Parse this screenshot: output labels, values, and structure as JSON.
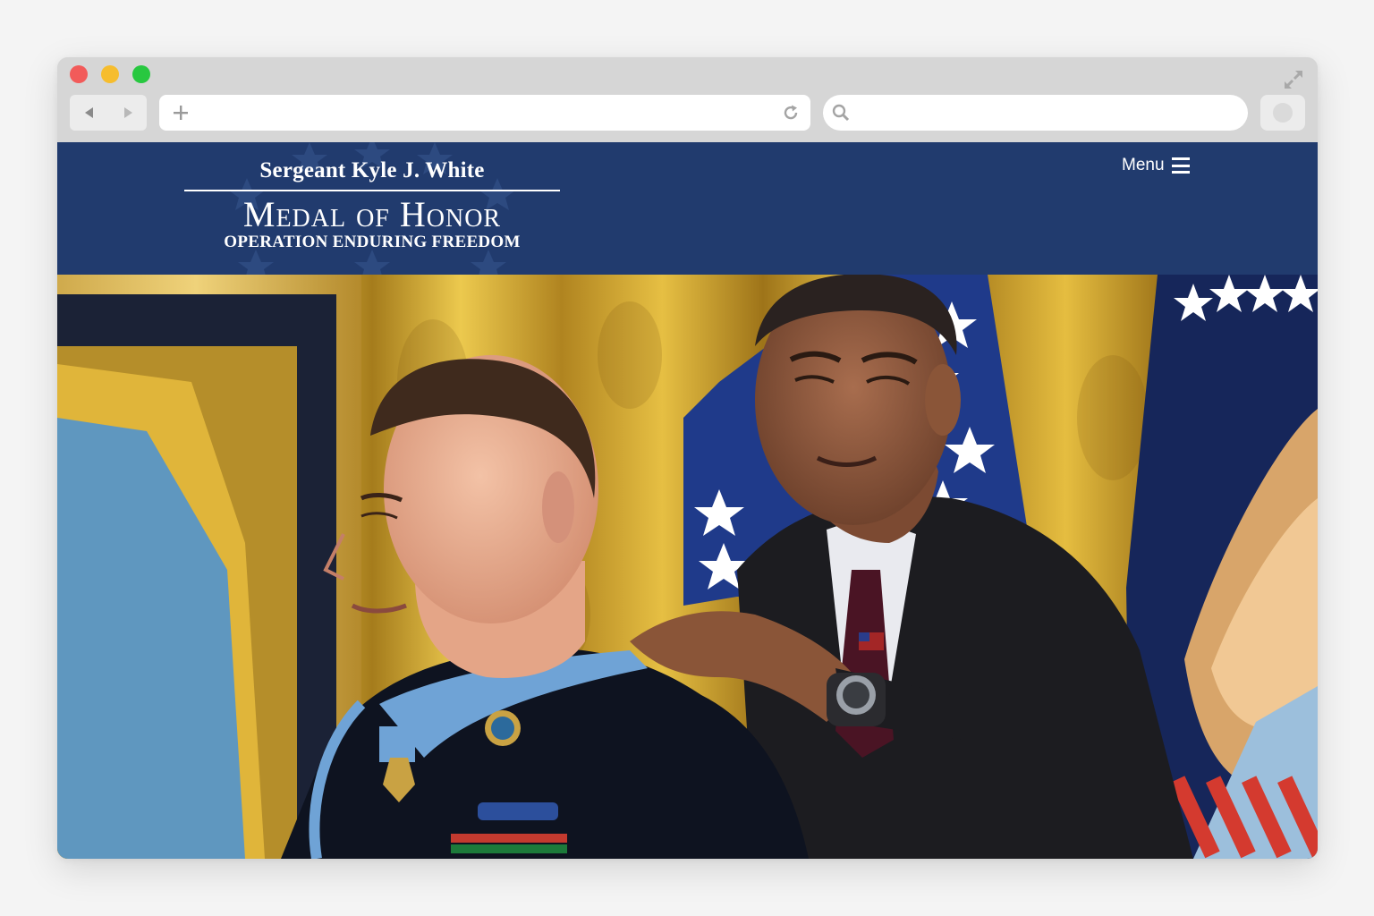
{
  "browser": {
    "url_value": "",
    "search_value": ""
  },
  "site": {
    "logo": {
      "line1": "Sergeant Kyle J. White",
      "line2": "Medal of Honor",
      "line3": "OPERATION ENDURING FREEDOM"
    },
    "menu_label": "Menu"
  },
  "colors": {
    "header_background": "#213b6e",
    "chrome_background": "#d6d6d6"
  },
  "icons": {
    "window_controls": [
      "close-icon",
      "minimize-icon",
      "maximize-icon"
    ],
    "toolbar": [
      "back-icon",
      "forward-icon",
      "new-tab-icon",
      "reload-icon",
      "search-icon",
      "fullscreen-icon",
      "extension-icon"
    ],
    "site": [
      "hamburger-icon"
    ]
  }
}
